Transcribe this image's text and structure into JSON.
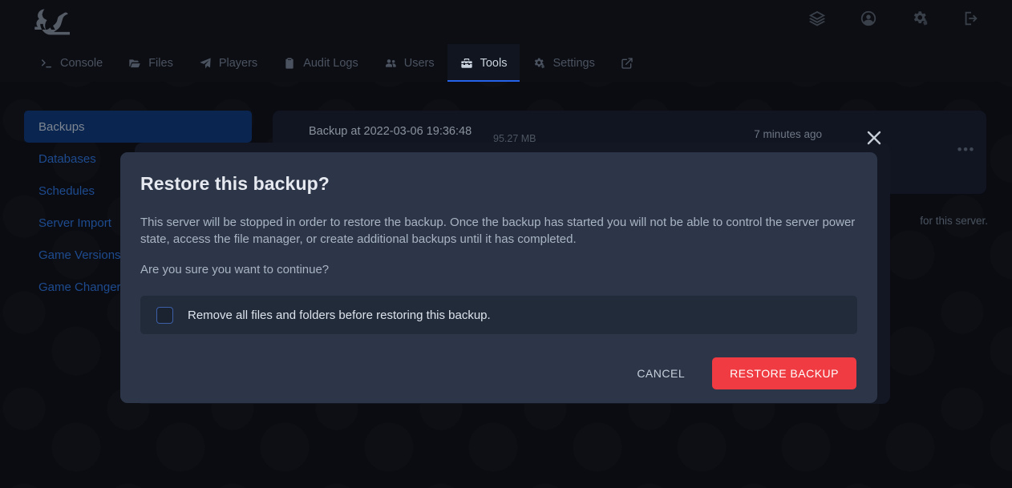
{
  "header": {
    "logo_icon": "squirrel-logo-icon",
    "icons": [
      {
        "name": "layers-icon",
        "label": "Layers"
      },
      {
        "name": "account-circle-icon",
        "label": "Account"
      },
      {
        "name": "cogs-icon",
        "label": "Admin Settings"
      },
      {
        "name": "logout-icon",
        "label": "Sign Out"
      }
    ]
  },
  "nav": {
    "tabs": [
      {
        "label": "Console",
        "icon": "terminal-icon",
        "active": false
      },
      {
        "label": "Files",
        "icon": "folder-open-icon",
        "active": false
      },
      {
        "label": "Players",
        "icon": "paper-plane-icon",
        "active": false
      },
      {
        "label": "Audit Logs",
        "icon": "clipboard-icon",
        "active": false
      },
      {
        "label": "Users",
        "icon": "users-icon",
        "active": false
      },
      {
        "label": "Tools",
        "icon": "toolbox-icon",
        "active": true
      },
      {
        "label": "Settings",
        "icon": "cogs-icon",
        "active": false
      },
      {
        "label": "",
        "icon": "external-link-icon",
        "active": false
      }
    ]
  },
  "sidebar": {
    "items": [
      {
        "label": "Backups",
        "active": true
      },
      {
        "label": "Databases",
        "active": false
      },
      {
        "label": "Schedules",
        "active": false
      },
      {
        "label": "Server Import",
        "active": false
      },
      {
        "label": "Game Versions",
        "active": false
      },
      {
        "label": "Game Changer",
        "active": false
      }
    ]
  },
  "main": {
    "backup": {
      "icon": "archive-box-icon",
      "title": "Backup at 2022-03-06 19:36:48",
      "size": "95.27 MB",
      "relative_time": "7 minutes ago",
      "menu_icon": "ellipsis-icon",
      "menu_glyph": "•••"
    },
    "server_note": "for this server."
  },
  "modal": {
    "title": "Restore this backup?",
    "body_paragraph_1": "This server will be stopped in order to restore the backup. Once the backup has started you will not be able to control the server power state, access the file manager, or create additional backups until it has completed.",
    "body_paragraph_2": "Are you sure you want to continue?",
    "checkbox": {
      "label": "Remove all files and folders before restoring this backup.",
      "checked": false
    },
    "cancel_label": "CANCEL",
    "confirm_label": "RESTORE BACKUP",
    "close_icon": "close-x-icon"
  },
  "colors": {
    "page_background": "#0a0c12",
    "header_background": "#0c0e14",
    "modal_background": "#2c3648",
    "card_background": "#111521",
    "accent_active_tab": "#2563eb",
    "sidebar_active_background": "#0a2550",
    "sidebar_link": "#1e4b8f",
    "danger_button": "#ef3b41",
    "checkbox_border": "#3c5fa8"
  }
}
